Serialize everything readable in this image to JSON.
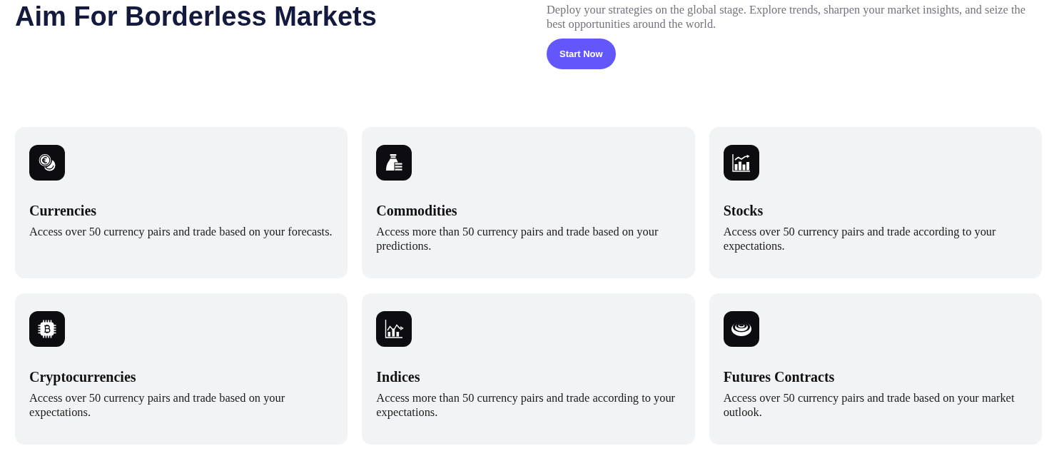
{
  "header": {
    "title": "Aim For Borderless Markets",
    "description": "Deploy your strategies on the global stage. Explore trends, sharpen your market insights, and seize the best opportunities around the world.",
    "button": "Start Now"
  },
  "markets": [
    {
      "title": "Currencies",
      "description": "Access over 50 currency pairs and trade based on your forecasts."
    },
    {
      "title": "Commodities",
      "description": "Access more than 50 currency pairs and trade based on your predictions."
    },
    {
      "title": "Stocks",
      "description": "Access over 50 currency pairs and trade according to your expectations."
    },
    {
      "title": "Cryptocurrencies",
      "description": "Access over 50 currency pairs and trade based on your expectations."
    },
    {
      "title": "Indices",
      "description": "Access more than 50 currency pairs and trade according to your expectations."
    },
    {
      "title": "Futures Contracts",
      "description": "Access over 50 currency pairs and trade based on your market outlook."
    }
  ]
}
